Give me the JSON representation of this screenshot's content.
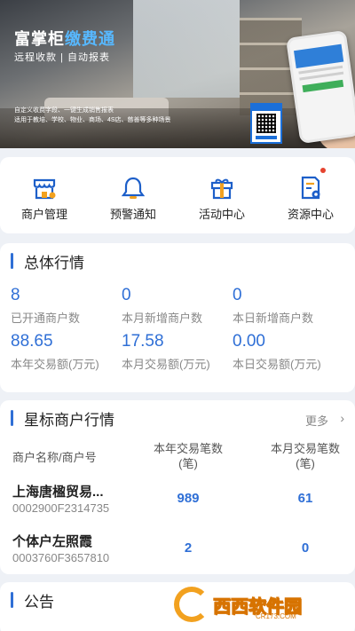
{
  "banner": {
    "brand_main": "富掌柜",
    "brand_accent": "缴费通",
    "subtitle": "远程收款 | 自动报表",
    "desc_line1": "自定义收费字段、一键生成销售报表",
    "desc_line2": "适用于教培、学校、物业、商场、4S店、慈善等多种场景"
  },
  "menu": [
    {
      "label": "商户管理",
      "icon": "shop-icon"
    },
    {
      "label": "预警通知",
      "icon": "bell-icon"
    },
    {
      "label": "活动中心",
      "icon": "gift-icon"
    },
    {
      "label": "资源中心",
      "icon": "document-gear-icon",
      "badge": true
    }
  ],
  "overview": {
    "title": "总体行情",
    "stats": [
      {
        "value": "8",
        "caption": "已开通商户数"
      },
      {
        "value": "0",
        "caption": "本月新增商户数"
      },
      {
        "value": "0",
        "caption": "本日新增商户数"
      },
      {
        "value": "88.65",
        "caption": "本年交易额(万元)"
      },
      {
        "value": "17.58",
        "caption": "本月交易额(万元)"
      },
      {
        "value": "0.00",
        "caption": "本日交易额(万元)"
      }
    ]
  },
  "star": {
    "title": "星标商户行情",
    "more": "更多",
    "col_name": "商户名称/商户号",
    "col_year_l1": "本年交易笔数",
    "col_year_l2": "(笔)",
    "col_month_l1": "本月交易笔数",
    "col_month_l2": "(笔)",
    "rows": [
      {
        "name": "上海唐楹贸易...",
        "no": "0002900F2314735",
        "year": "989",
        "month": "61"
      },
      {
        "name": "个体户左照霞",
        "no": "0003760F3657810",
        "year": "2",
        "month": "0"
      }
    ]
  },
  "notice": {
    "title": "公告"
  },
  "watermark": {
    "text": "西西软件园",
    "url": "CR173.COM"
  },
  "colors": {
    "accent": "#2f6fd6",
    "badge": "#e5432f"
  }
}
